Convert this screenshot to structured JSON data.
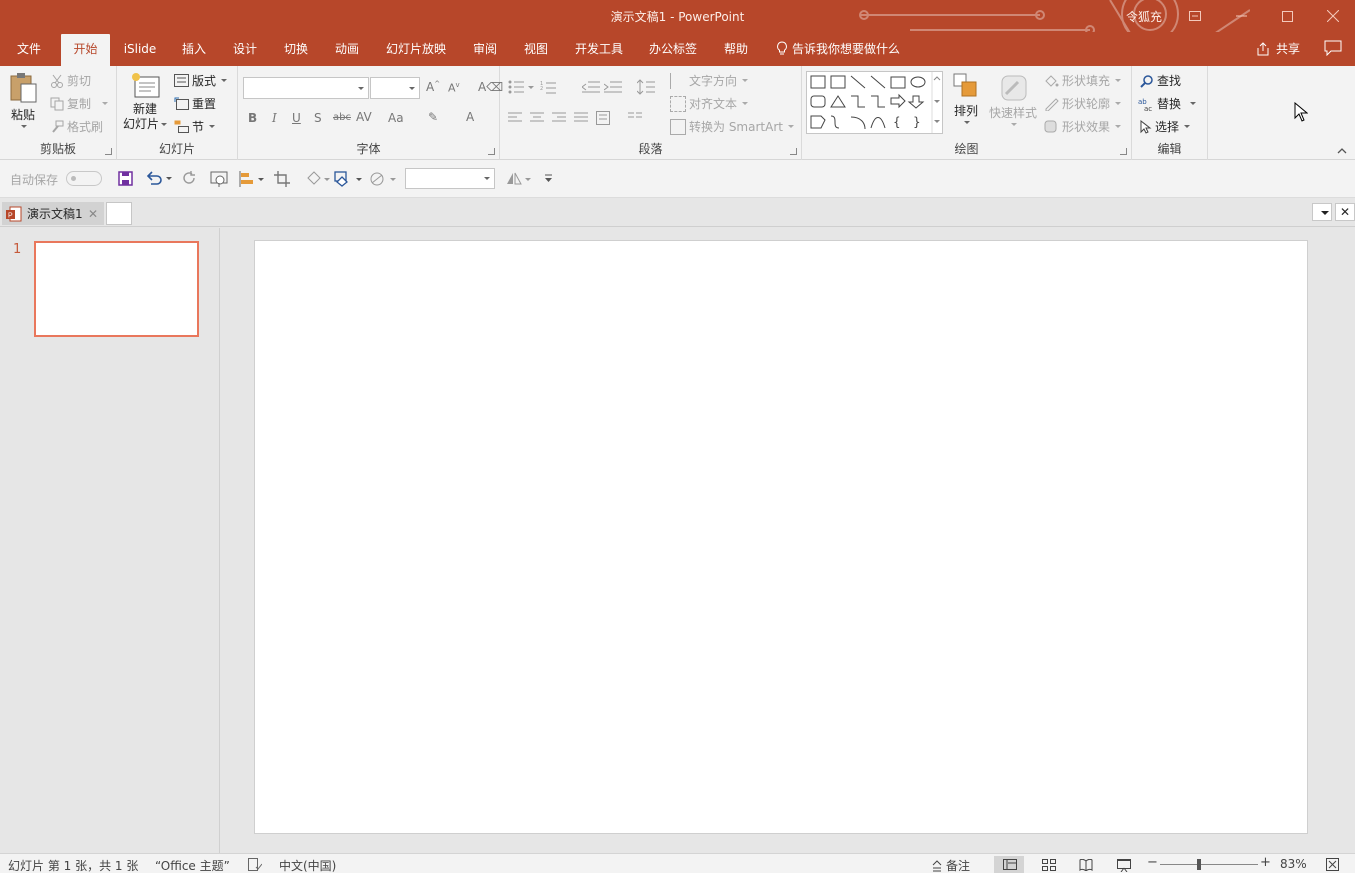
{
  "window": {
    "title": "演示文稿1  -  PowerPoint",
    "user": "令狐充"
  },
  "menu": {
    "tabs": [
      "文件",
      "开始",
      "iSlide",
      "插入",
      "设计",
      "切换",
      "动画",
      "幻灯片放映",
      "审阅",
      "视图",
      "开发工具",
      "办公标签",
      "帮助"
    ],
    "active_tab": "开始",
    "tell_me": "告诉我你想要做什么",
    "share": "共享"
  },
  "ribbon": {
    "clipboard": {
      "label": "剪贴板",
      "paste": "粘贴",
      "cut": "剪切",
      "copy": "复制",
      "format_painter": "格式刷"
    },
    "slides": {
      "label": "幻灯片",
      "new_slide_line1": "新建",
      "new_slide_line2": "幻灯片",
      "layout": "版式",
      "reset": "重置",
      "section": "节"
    },
    "font": {
      "label": "字体",
      "font_name": "",
      "font_size": ""
    },
    "paragraph": {
      "label": "段落",
      "text_direction": "文字方向",
      "align_text": "对齐文本",
      "convert_smartart": "转换为 SmartArt"
    },
    "drawing": {
      "label": "绘图",
      "arrange": "排列",
      "quick_styles": "快速样式",
      "shape_fill": "形状填充",
      "shape_outline": "形状轮廓",
      "shape_effects": "形状效果"
    },
    "editing": {
      "label": "编辑",
      "find": "查找",
      "replace": "替换",
      "select": "选择"
    }
  },
  "qat": {
    "autosave": "自动保存"
  },
  "document_tabs": {
    "active": "演示文稿1"
  },
  "slides_panel": {
    "slide_number": "1"
  },
  "statusbar": {
    "slide_info": "幻灯片 第 1 张，共 1 张",
    "theme": "“Office 主题”",
    "language": "中文(中国)",
    "notes": "备注",
    "zoom": "83%"
  },
  "colors": {
    "accent": "#b7472a",
    "thumb_border": "#e9775c"
  }
}
